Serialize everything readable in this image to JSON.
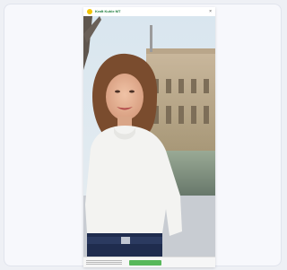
{
  "header": {
    "brand": "Kraft Kuhle MT",
    "close_icon": "close-icon"
  },
  "photo": {
    "subject": "portrait-photo"
  },
  "footer": {
    "accept_label": "",
    "link_middle": "",
    "link_right": ""
  },
  "colors": {
    "page_bg": "#eef0f5",
    "card_bg": "#f7f8fc",
    "brand_green": "#1a7a3a",
    "logo_yellow": "#f2c300",
    "button_green": "#58b85a"
  }
}
